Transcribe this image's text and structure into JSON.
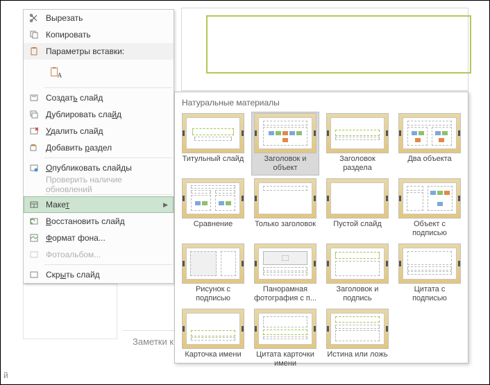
{
  "context_menu": {
    "cut": "Вырезать",
    "copy": "Копировать",
    "paste_options_header": "Параметры вставки:",
    "new_slide_pre": "Создат",
    "new_slide_u": "ь",
    "new_slide_post": " слайд",
    "duplicate_pre": "Дублировать сла",
    "duplicate_u": "й",
    "duplicate_post": "д",
    "delete_pre": "",
    "delete_u": "У",
    "delete_post": "далить слайд",
    "add_section_pre": "Добавить ",
    "add_section_u": "р",
    "add_section_post": "аздел",
    "publish_pre": "",
    "publish_u": "О",
    "publish_post": "публиковать слайды",
    "check_updates": "Проверить наличие обновлений",
    "layout_pre": "Маке",
    "layout_u": "т",
    "restore_pre": "",
    "restore_u": "В",
    "restore_post": "осстановить слайд",
    "format_bg_pre": "",
    "format_bg_u": "Ф",
    "format_bg_post": "ормат фона...",
    "photo_album": "Фотоальбом...",
    "hide_pre": "Скр",
    "hide_u": "ы",
    "hide_post": "ть слайд"
  },
  "flyout": {
    "title": "Натуральные материалы",
    "layouts": [
      "Титульный слайд",
      "Заголовок и объект",
      "Заголовок раздела",
      "Два объекта",
      "Сравнение",
      "Только заголовок",
      "Пустой слайд",
      "Объект с подписью",
      "Рисунок с подписью",
      "Панорамная фотография с п...",
      "Заголовок и подпись",
      "Цитата с подписью",
      "Карточка имени",
      "Цитата карточки имени",
      "Истина или ложь"
    ]
  },
  "notes_placeholder": "Заметки к слайду",
  "statusbar_fragment": "й"
}
